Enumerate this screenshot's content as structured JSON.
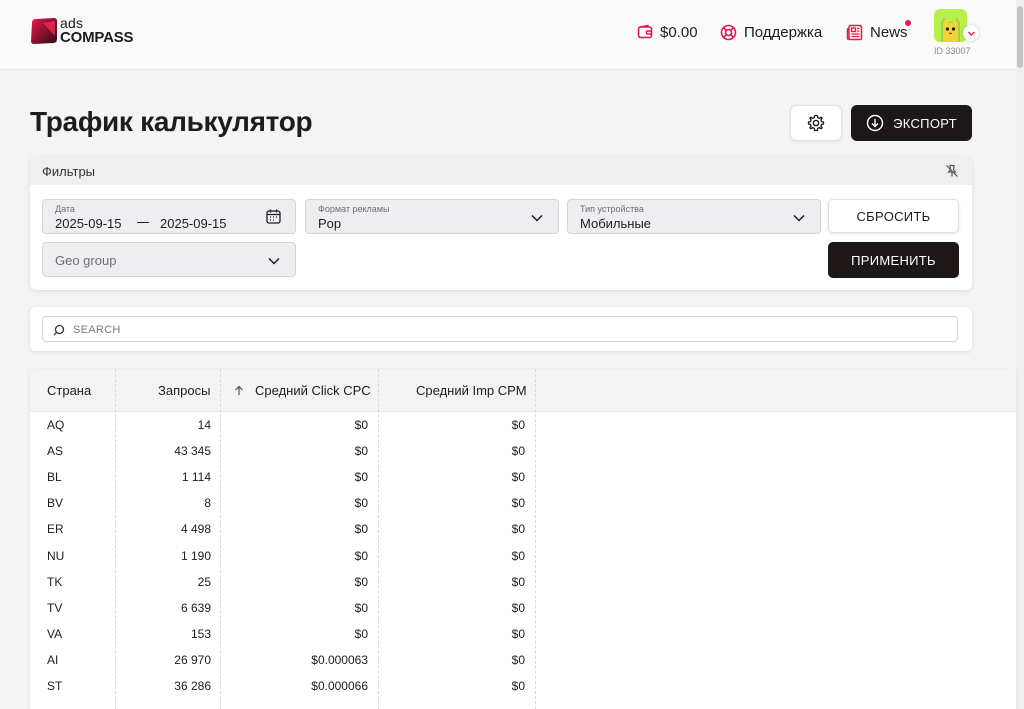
{
  "header": {
    "logo_top": "ads",
    "logo_bottom": "COMPASS",
    "balance": "$0.00",
    "support": "Поддержка",
    "news": "News",
    "user_id": "ID 33007"
  },
  "page": {
    "title": "Трафик калькулятор",
    "export_label": "ЭКСПОРТ"
  },
  "filters": {
    "title": "Фильтры",
    "date_label": "Дата",
    "date_from": "2025-09-15",
    "date_to": "2025-09-15",
    "format_label": "Формат рекламы",
    "format_value": "Pop",
    "device_label": "Тип устройства",
    "device_value": "Мобильные",
    "geo_placeholder": "Geo group",
    "reset_label": "СБРОСИТЬ",
    "apply_label": "ПРИМЕНИТЬ"
  },
  "search": {
    "placeholder": "SEARCH"
  },
  "table": {
    "columns": [
      "Страна",
      "Запросы",
      "Средний Click CPC",
      "Средний Imp CPM"
    ],
    "rows": [
      {
        "country": "AQ",
        "requests": "14",
        "cpc": "$0",
        "cpm": "$0"
      },
      {
        "country": "AS",
        "requests": "43 345",
        "cpc": "$0",
        "cpm": "$0"
      },
      {
        "country": "BL",
        "requests": "1 114",
        "cpc": "$0",
        "cpm": "$0"
      },
      {
        "country": "BV",
        "requests": "8",
        "cpc": "$0",
        "cpm": "$0"
      },
      {
        "country": "ER",
        "requests": "4 498",
        "cpc": "$0",
        "cpm": "$0"
      },
      {
        "country": "NU",
        "requests": "1 190",
        "cpc": "$0",
        "cpm": "$0"
      },
      {
        "country": "TK",
        "requests": "25",
        "cpc": "$0",
        "cpm": "$0"
      },
      {
        "country": "TV",
        "requests": "6 639",
        "cpc": "$0",
        "cpm": "$0"
      },
      {
        "country": "VA",
        "requests": "153",
        "cpc": "$0",
        "cpm": "$0"
      },
      {
        "country": "AI",
        "requests": "26 970",
        "cpc": "$0.000063",
        "cpm": "$0"
      },
      {
        "country": "ST",
        "requests": "36 286",
        "cpc": "$0.000066",
        "cpm": "$0"
      }
    ]
  },
  "colors": {
    "brand_red": "#e8174a",
    "dark_button": "#1d1718",
    "avatar_green": "#b8f04a"
  }
}
